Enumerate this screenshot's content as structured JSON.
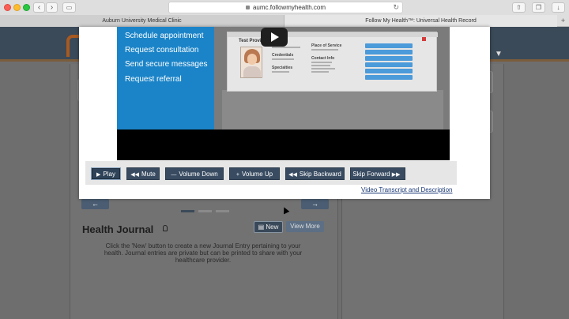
{
  "browser": {
    "address": "aumc.followmyhealth.com",
    "tabs": [
      {
        "label": "Auburn University Medical Clinic"
      },
      {
        "label": "Follow My Health™: Universal Health Record"
      }
    ],
    "new_tab": "+"
  },
  "video": {
    "promo_items": [
      "Schedule appointment",
      "Request consultation",
      "Send secure messages",
      "Request referral"
    ],
    "card_title": "Test Provi",
    "card_labels": {
      "place_of_service": "Place of Service",
      "credentials": "Credentials",
      "contact_info": "Contact Info",
      "specialties": "Specialties"
    }
  },
  "controls": [
    {
      "icon": "▶",
      "label": "Play",
      "name": "play-button"
    },
    {
      "icon": "◀◀",
      "label": "Mute",
      "name": "mute-button"
    },
    {
      "icon": "—",
      "label": "Volume Down",
      "name": "volume-down-button"
    },
    {
      "icon": "+",
      "label": "Volume Up",
      "name": "volume-up-button"
    },
    {
      "icon": "◀◀",
      "label": "Skip Backward",
      "name": "skip-backward-button"
    },
    {
      "icon": "▶▶",
      "label": "Skip Forward",
      "name": "skip-forward-button"
    }
  ],
  "transcript_link": "Video Transcript and Description",
  "journal": {
    "title": "Health Journal",
    "new_label": "New",
    "view_more_label": "View More",
    "description": "Click the 'New' button to create a new Journal Entry pertaining to your health. Journal entries are private but can be printed to share with your healthcare provider."
  },
  "pager": {
    "prev": "←",
    "next": "→",
    "page_count": 3,
    "current_page": 1
  }
}
